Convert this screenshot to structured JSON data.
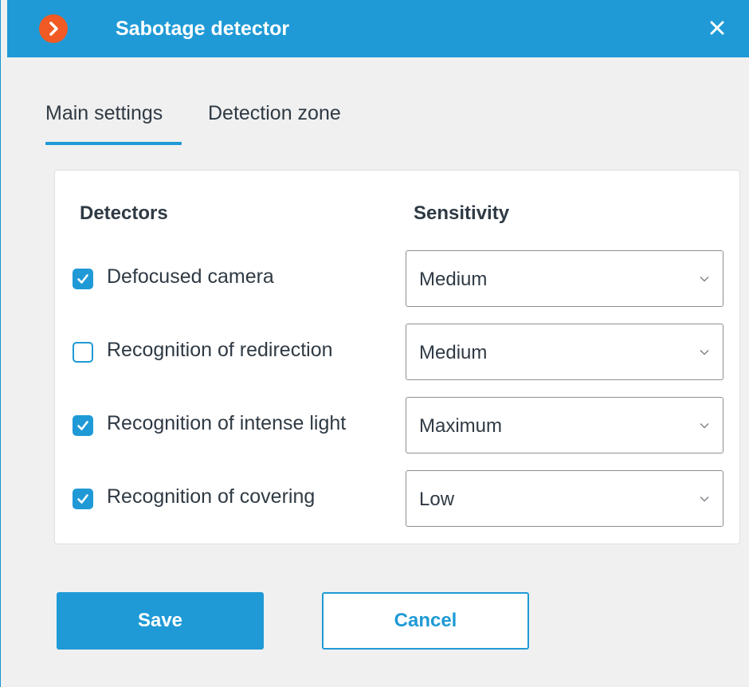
{
  "window": {
    "title": "Sabotage detector",
    "accent_color": "#1f9ad6",
    "logo_color": "#f15a24"
  },
  "tabs": [
    {
      "label": "Main settings",
      "active": true
    },
    {
      "label": "Detection zone",
      "active": false
    }
  ],
  "panel": {
    "header_detectors": "Detectors",
    "header_sensitivity": "Sensitivity",
    "rows": [
      {
        "label": "Defocused camera",
        "checked": true,
        "sensitivity": "Medium"
      },
      {
        "label": "Recognition of redirection",
        "checked": false,
        "sensitivity": "Medium"
      },
      {
        "label": "Recognition of intense light",
        "checked": true,
        "sensitivity": "Maximum"
      },
      {
        "label": "Recognition of covering",
        "checked": true,
        "sensitivity": "Low"
      }
    ]
  },
  "buttons": {
    "save_label": "Save",
    "cancel_label": "Cancel"
  },
  "icons": {
    "logo": "chevron-right-icon",
    "close": "close-icon",
    "checkbox_checked": "checkmark-icon",
    "dropdown": "chevron-down-icon"
  }
}
